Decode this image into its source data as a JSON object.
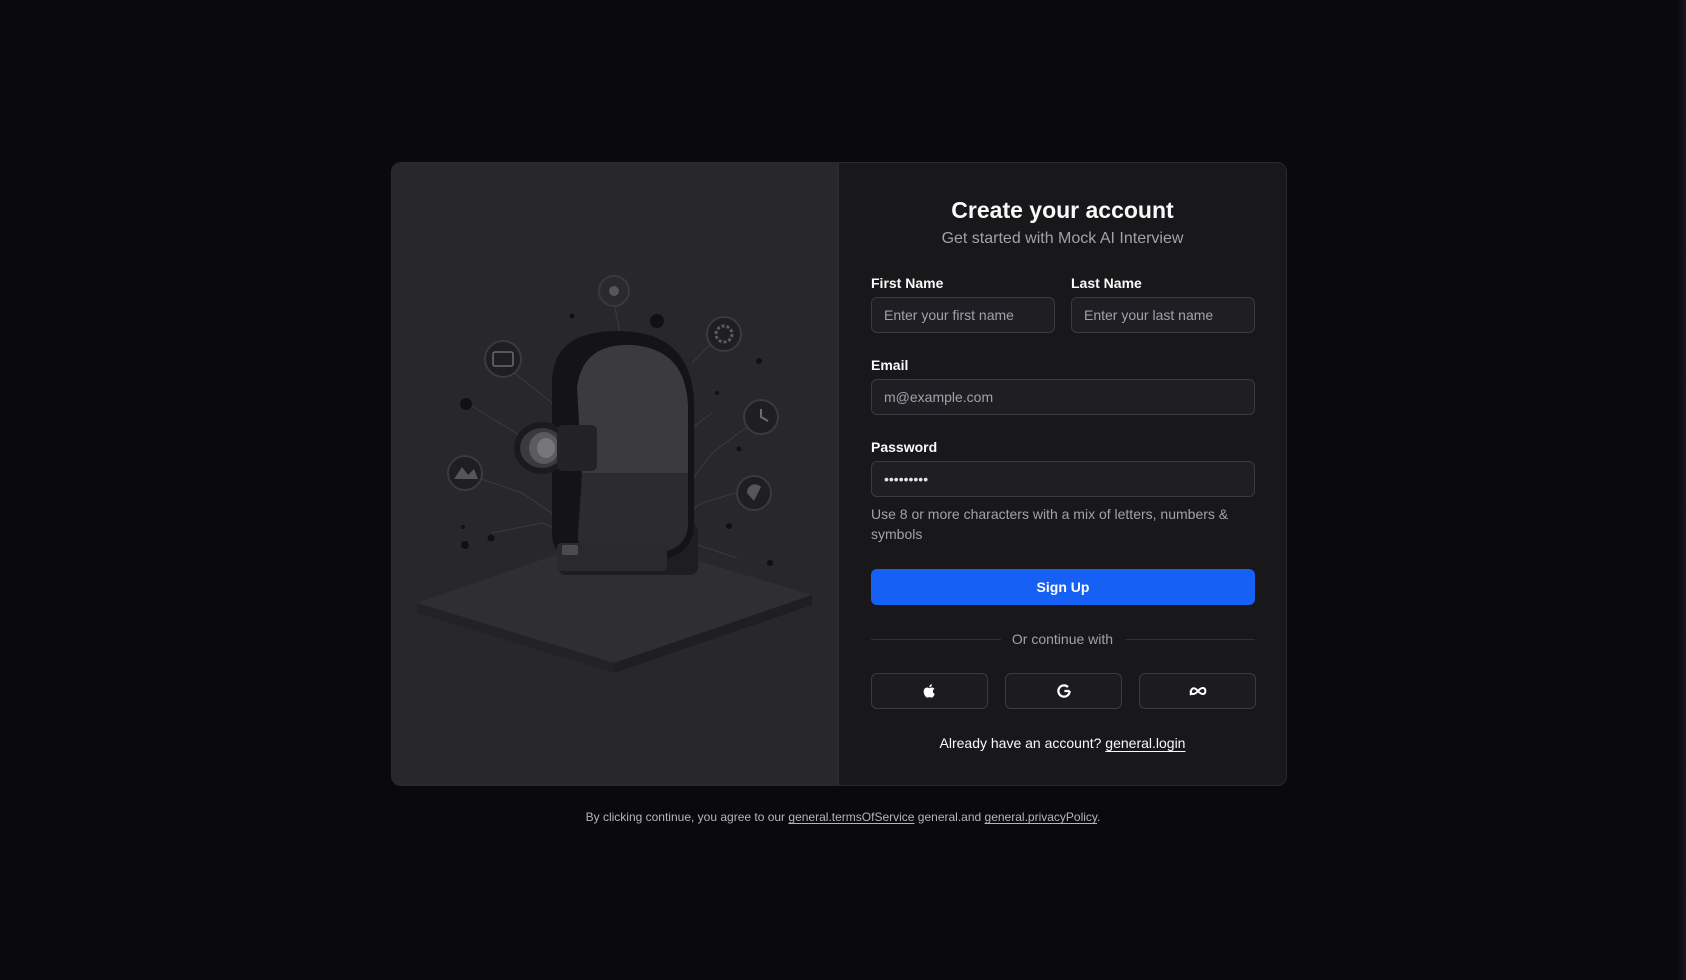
{
  "form": {
    "title": "Create your account",
    "subtitle": "Get started with Mock AI Interview",
    "first_name_label": "First Name",
    "first_name_placeholder": "Enter your first name",
    "last_name_label": "Last Name",
    "last_name_placeholder": "Enter your last name",
    "email_label": "Email",
    "email_placeholder": "m@example.com",
    "password_label": "Password",
    "password_value": "password1",
    "password_hint": "Use 8 or more characters with a mix of letters, numbers & symbols",
    "signup_label": "Sign Up",
    "divider_text": "Or continue with",
    "social": [
      {
        "name": "apple-icon"
      },
      {
        "name": "google-icon"
      },
      {
        "name": "meta-icon"
      }
    ],
    "login_prompt": "Already have an account?",
    "login_link": "general.login"
  },
  "footer": {
    "prefix": "By clicking continue, you agree to our",
    "terms_link": "general.termsOfService",
    "and_text": "general.and",
    "privacy_link": "general.privacyPolicy",
    "suffix": "."
  },
  "colors": {
    "background": "#0a0a0d",
    "card": "#18181b",
    "illustration_bg": "#28282b",
    "primary": "#1660f5"
  }
}
